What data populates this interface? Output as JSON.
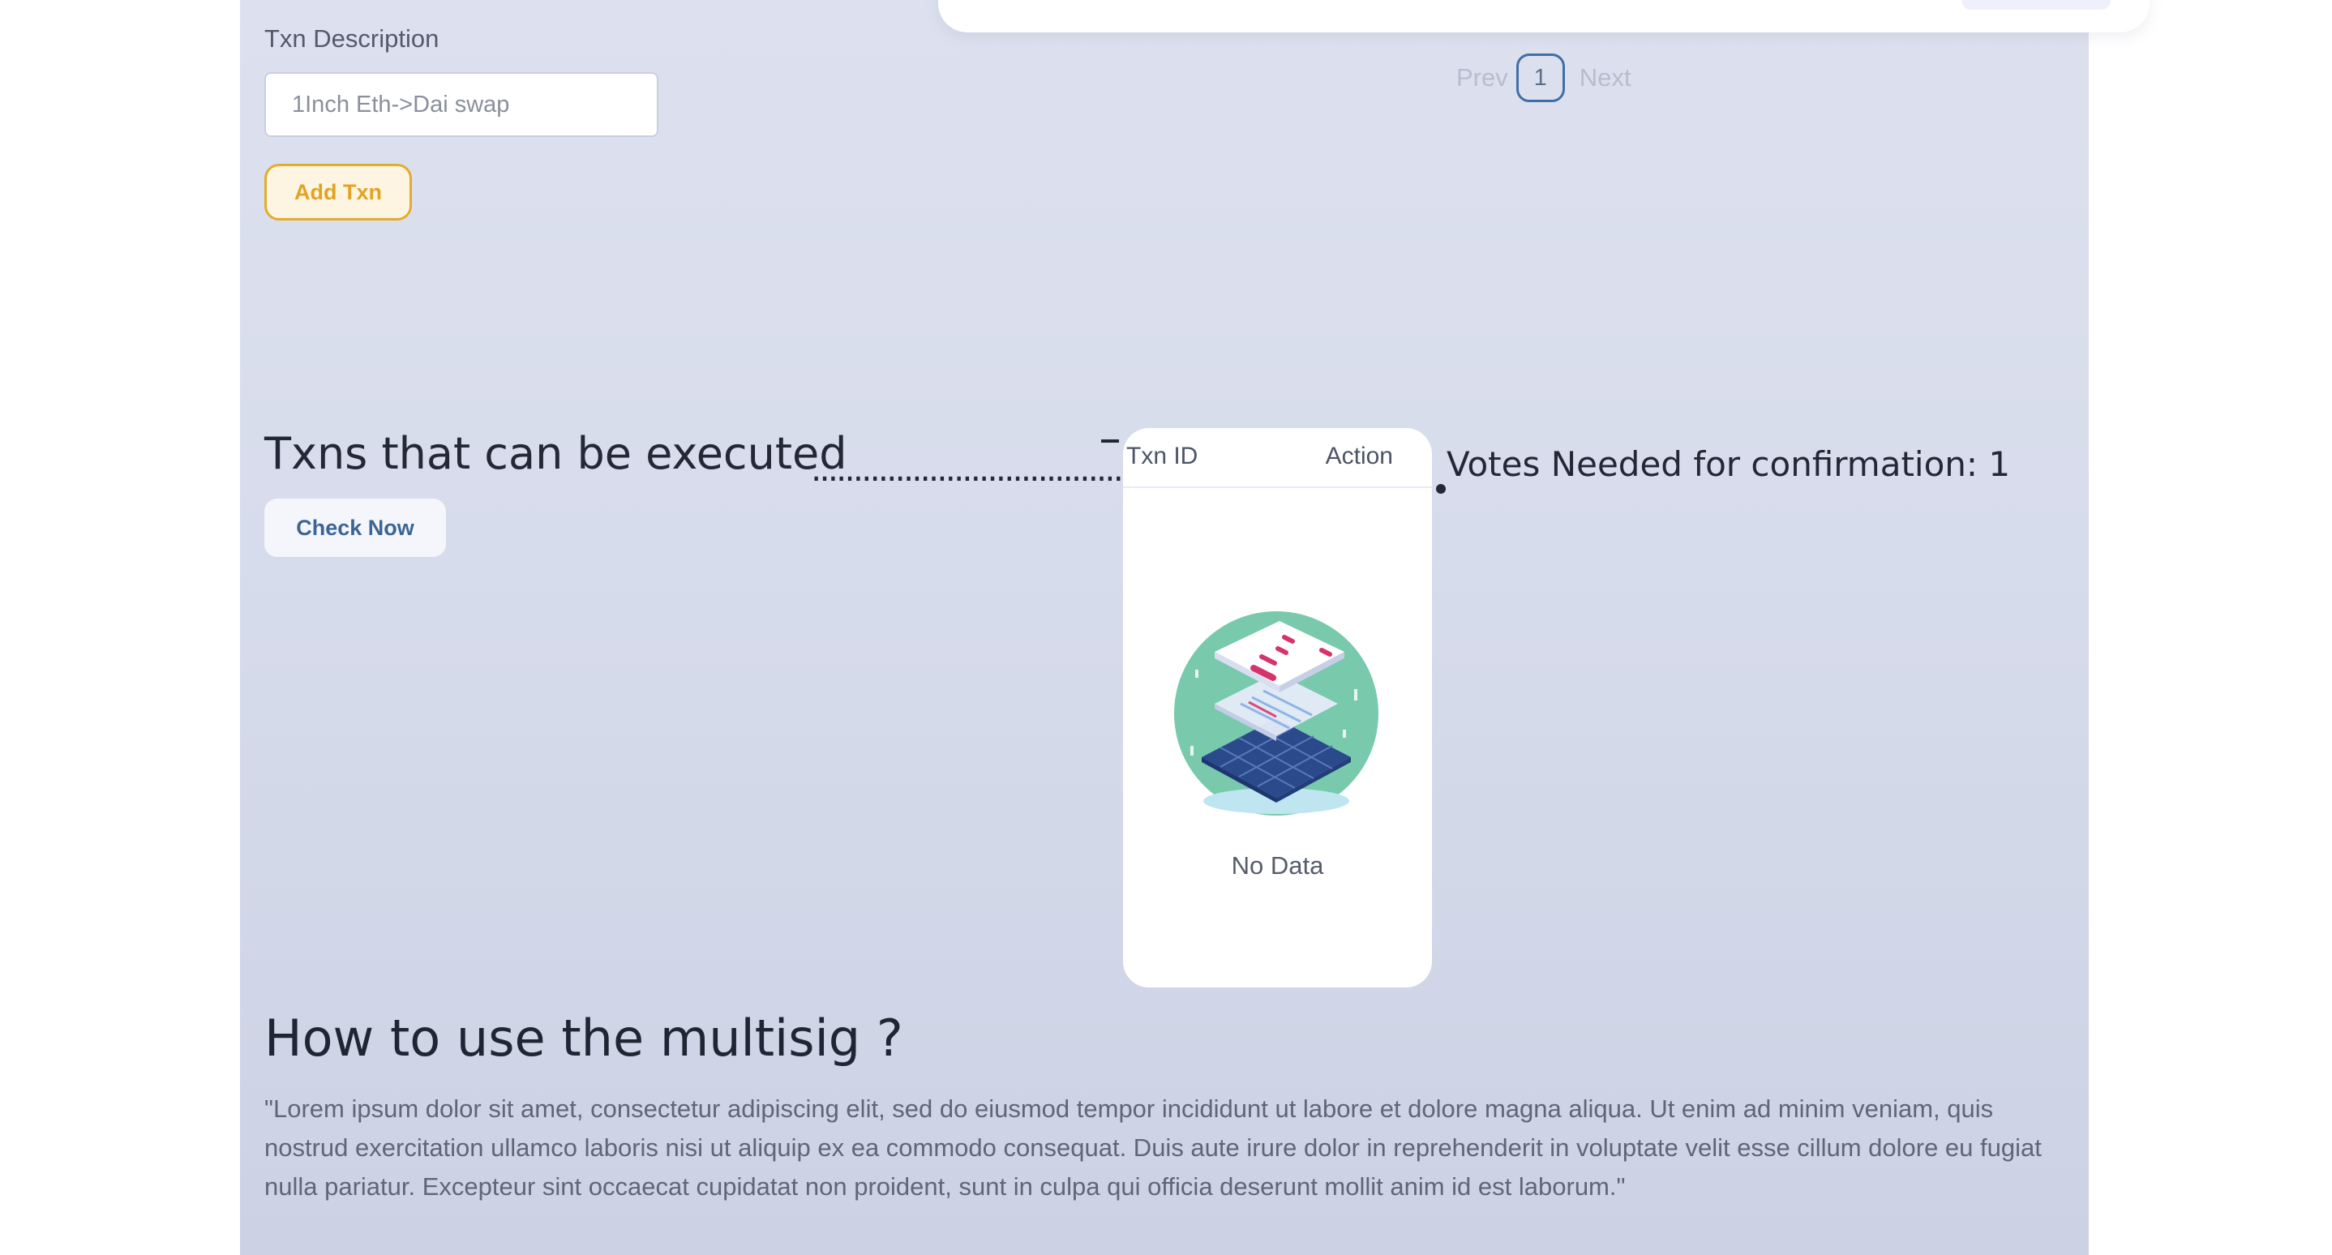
{
  "form": {
    "label": "Txn Description",
    "placeholder": "1Inch Eth->Dai swap",
    "add_button": "Add Txn"
  },
  "pagination": {
    "prev": "Prev",
    "page": "1",
    "next": "Next"
  },
  "executable": {
    "title": "Txns that can be executed",
    "dots": ".....................................",
    "check_button": "Check Now",
    "votes_needed": "Votes Needed for confirmation: 1"
  },
  "table": {
    "columns": [
      "Txn ID",
      "Action"
    ],
    "empty_text": "No Data"
  },
  "help": {
    "title": "How to use the multisig ?",
    "body": "\"Lorem ipsum dolor sit amet, consectetur adipiscing elit, sed do eiusmod tempor incididunt ut labore et dolore magna aliqua. Ut enim ad minim veniam, quis nostrud exercitation ullamco laboris nisi ut aliquip ex ea commodo consequat. Duis aute irure dolor in reprehenderit in voluptate velit esse cillum dolore eu fugiat nulla pariatur. Excepteur sint occaecat cupidatat non proident, sunt in culpa qui officia deserunt mollit anim id est laborum.\""
  },
  "colors": {
    "accent_orange": "#e3ad2c",
    "accent_blue": "#3b6694",
    "panel_bg": "#d6dbeb"
  },
  "icons": {
    "empty_state": "empty-data-illustration"
  }
}
